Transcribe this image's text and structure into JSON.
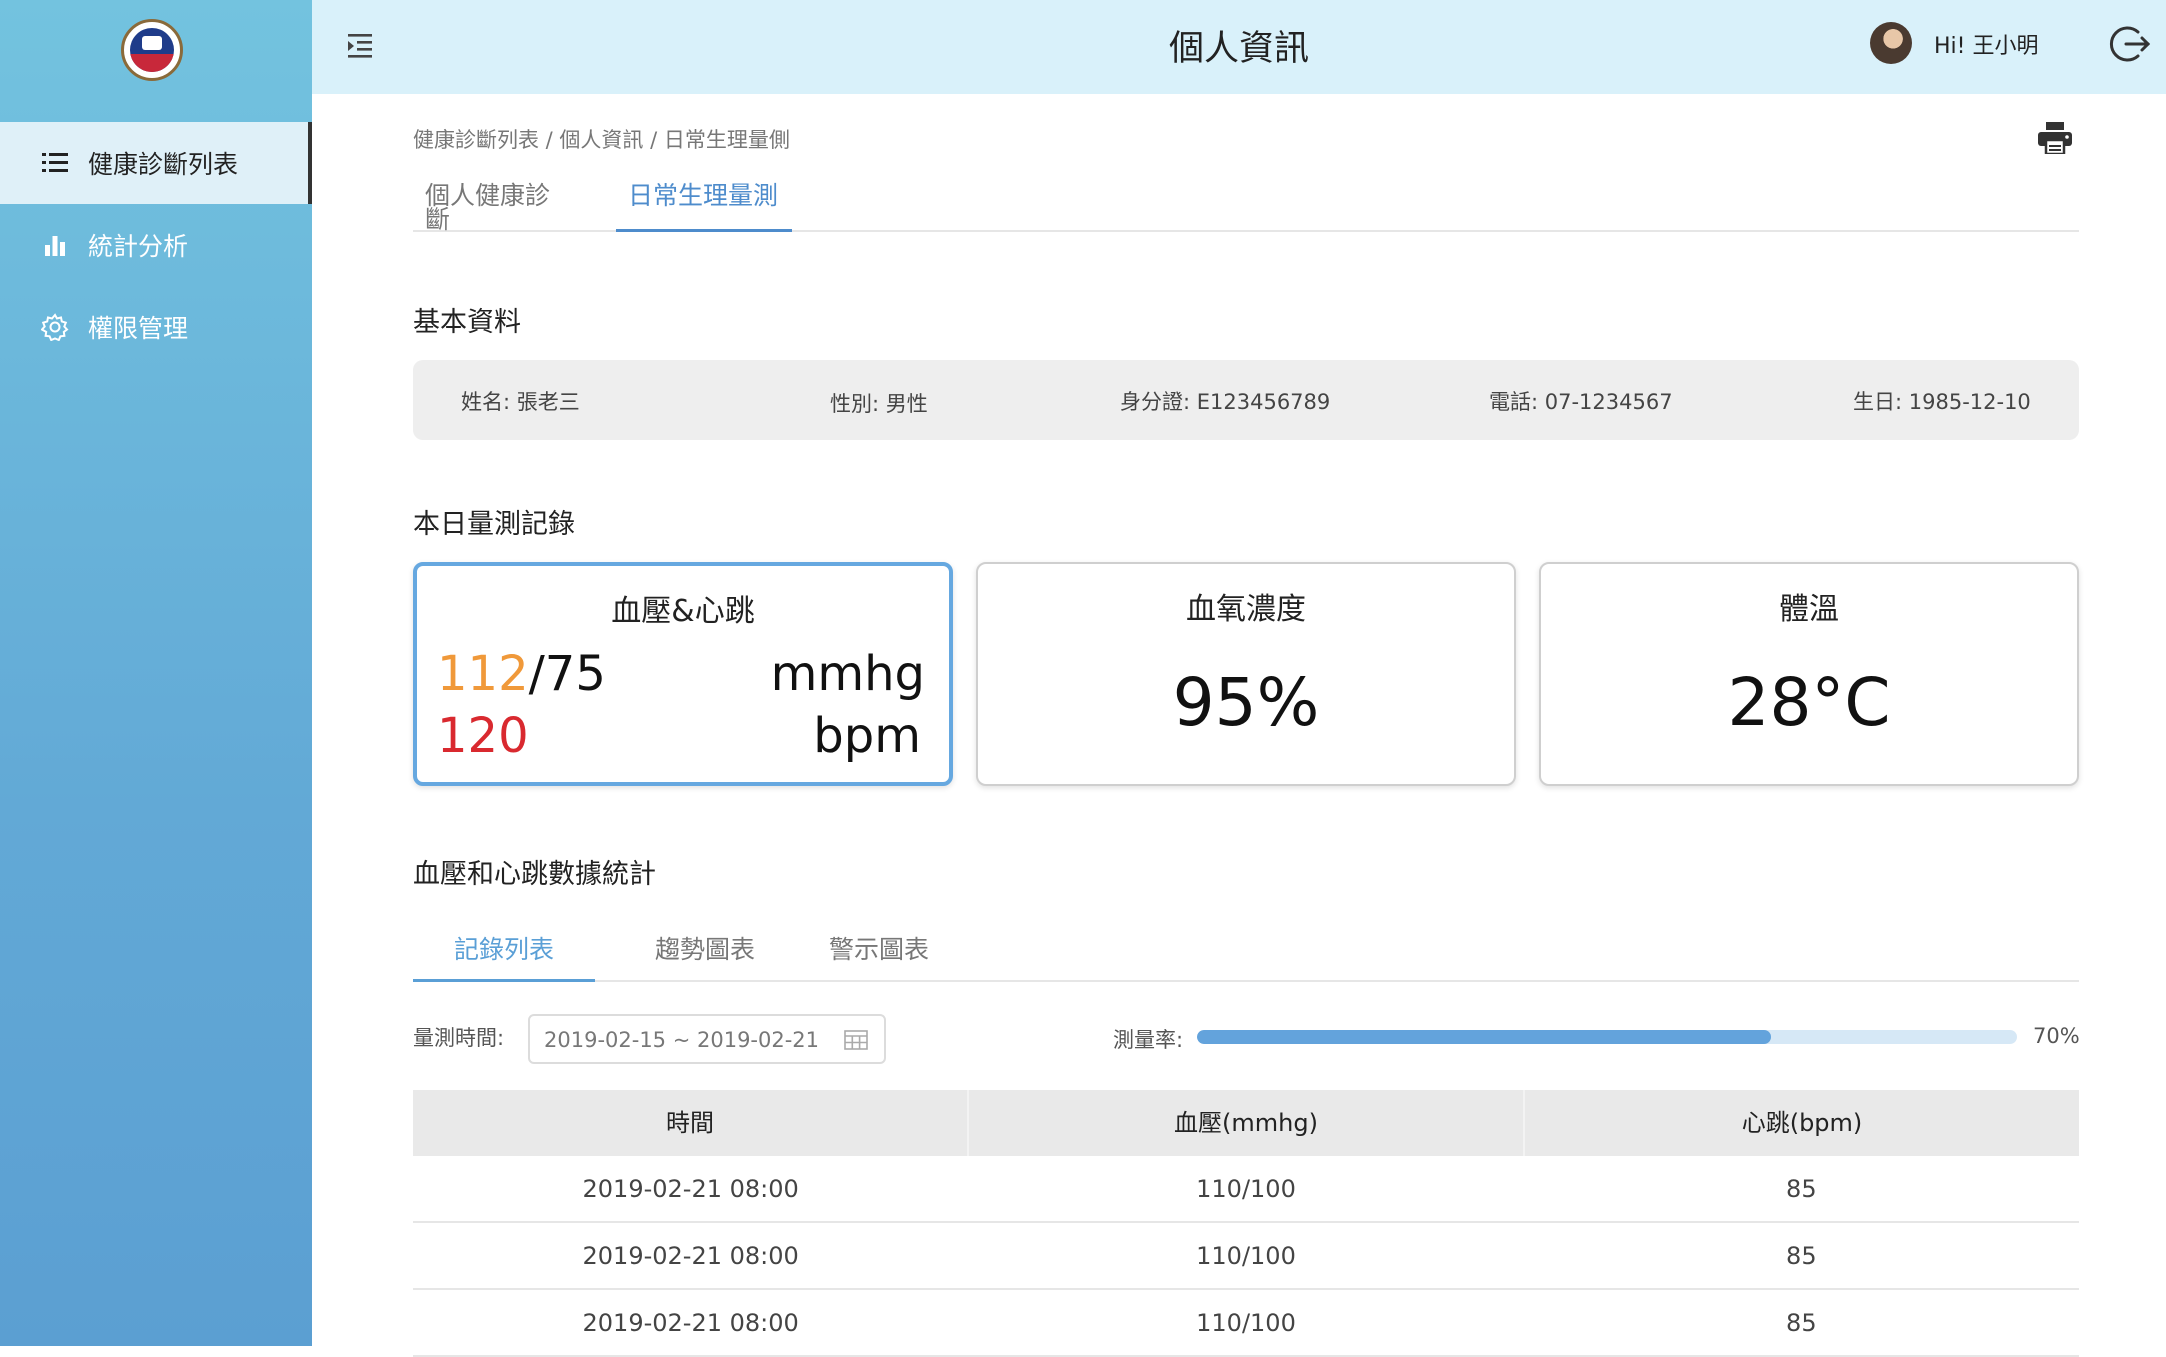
{
  "header": {
    "title": "個人資訊",
    "greeting": "Hi!  王小明"
  },
  "sidebar": {
    "items": [
      {
        "label": "健康診斷列表",
        "icon": "list-icon",
        "active": true
      },
      {
        "label": "統計分析",
        "icon": "bar-chart-icon",
        "active": false
      },
      {
        "label": "權限管理",
        "icon": "gear-icon",
        "active": false
      }
    ]
  },
  "breadcrumb": "健康診斷列表  / 個人資訊 / 日常生理量側",
  "tabs": [
    {
      "label": "個人健康診斷",
      "active": false
    },
    {
      "label": "日常生理量測",
      "active": true
    }
  ],
  "basic_info": {
    "title": "基本資料",
    "name": "姓名: 張老三",
    "gender": "性別:  男性",
    "id": "身分證:  E123456789",
    "phone": "電話:  07-1234567",
    "birthday": "生日:  1985-12-10"
  },
  "today": {
    "title": "本日量測記錄",
    "bp_card": {
      "title": "血壓&心跳",
      "systolic": "112",
      "diastolic": "/75",
      "bp_unit": "mmhg",
      "heart_rate": "120",
      "hr_unit": "bpm"
    },
    "spo2_card": {
      "title": "血氧濃度",
      "value": "95%"
    },
    "temp_card": {
      "title": "體溫",
      "value": "28°C"
    }
  },
  "stats": {
    "title": "血壓和心跳數據統計",
    "subtabs": [
      {
        "label": "記錄列表",
        "active": true
      },
      {
        "label": "趨勢圖表",
        "active": false
      },
      {
        "label": "警示圖表",
        "active": false
      }
    ],
    "filter_label": "量測時間:",
    "date_range": "2019-02-15  ~  2019-02-21",
    "rate_label": "測量率:",
    "rate_value": "70%",
    "rate_fraction": 0.7,
    "columns": [
      "時間",
      "血壓(mmhg)",
      "心跳(bpm)"
    ],
    "rows": [
      [
        "2019-02-21 08:00",
        "110/100",
        "85"
      ],
      [
        "2019-02-21 08:00",
        "110/100",
        "85"
      ],
      [
        "2019-02-21 08:00",
        "110/100",
        "85"
      ]
    ]
  },
  "colors": {
    "accent": "#4e8ccc",
    "systolic": "#f0993a",
    "heart_rate": "#d9292f"
  }
}
